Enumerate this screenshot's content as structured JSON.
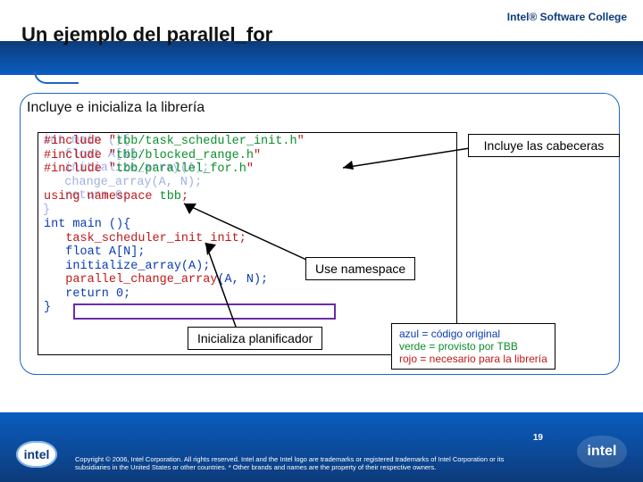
{
  "brand": "Intel® Software College",
  "title": "Un ejemplo del parallel_for",
  "subtitle": "Incluye e inicializa la librería",
  "code_layer_bg": "int main (){\n   float A[N];\n   initialize_array(A);\n   change_array(A, N);\n   return 0;\n}",
  "code": {
    "l1a": "#include \"",
    "l1b": "tbb/task_scheduler_init.h",
    "l1c": "\"",
    "l2a": "#include \"",
    "l2b": "tbb/blocked_range.h",
    "l2c": "\"",
    "l3a": "#include \"",
    "l3b": "tbb/parallel_for.h",
    "l3c": "\"",
    "l4": "",
    "l5a": "using namespace ",
    "l5b": "tbb",
    "l5c": ";",
    "l6": "",
    "l7": "int main (){",
    "l8a": "   ",
    "l8b": "task_scheduler_init init;",
    "l9": "   float A[N];",
    "l10": "   initialize_array(A);",
    "l11a": "   parallel_change_array",
    "l11b": "(A, N);",
    "l12": "   return 0;",
    "l13": "}"
  },
  "callouts": {
    "headers": "Incluye las cabeceras",
    "namespace": "Use namespace",
    "init": "Inicializa planificador"
  },
  "legend": {
    "l1": "azul = código original",
    "l2": "verde = provisto por TBB",
    "l3": "rojo = necesario para la librería"
  },
  "footer": {
    "copyright": "Copyright © 2006, Intel Corporation. All rights reserved.\nIntel and the Intel logo are trademarks or registered trademarks of Intel Corporation or its subsidiaries in the United States or other countries. * Other brands and names are the property of their respective owners.",
    "page": "19",
    "logo": "intel"
  }
}
